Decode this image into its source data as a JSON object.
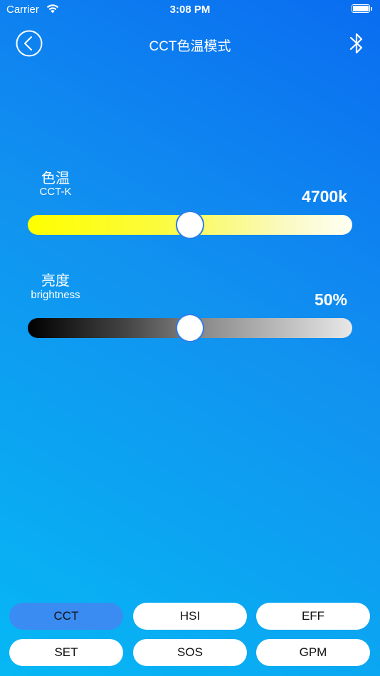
{
  "status_bar": {
    "carrier": "Carrier",
    "time": "3:08 PM",
    "wifi_icon": "wifi-icon",
    "battery_icon": "battery-icon"
  },
  "nav": {
    "title": "CCT色温模式",
    "back_icon": "back-chevron-icon",
    "bluetooth_icon": "bluetooth-icon"
  },
  "sliders": {
    "cct": {
      "label": "色温",
      "sublabel": "CCT-K",
      "value_text": "4700k",
      "fraction": 0.5,
      "gradient_colors": [
        "#ffff00",
        "#fffff4"
      ]
    },
    "brightness": {
      "label": "亮度",
      "sublabel": "brightness",
      "value_text": "50%",
      "fraction": 0.5,
      "gradient_colors": [
        "#000000",
        "#e8e8e8"
      ]
    }
  },
  "modes": [
    {
      "label": "CCT",
      "active": true
    },
    {
      "label": "HSI",
      "active": false
    },
    {
      "label": "EFF",
      "active": false
    },
    {
      "label": "SET",
      "active": false
    },
    {
      "label": "SOS",
      "active": false
    },
    {
      "label": "GPM",
      "active": false
    }
  ],
  "colors": {
    "accent": "#3a8cf2",
    "thumb_border": "#2f7ee6"
  }
}
